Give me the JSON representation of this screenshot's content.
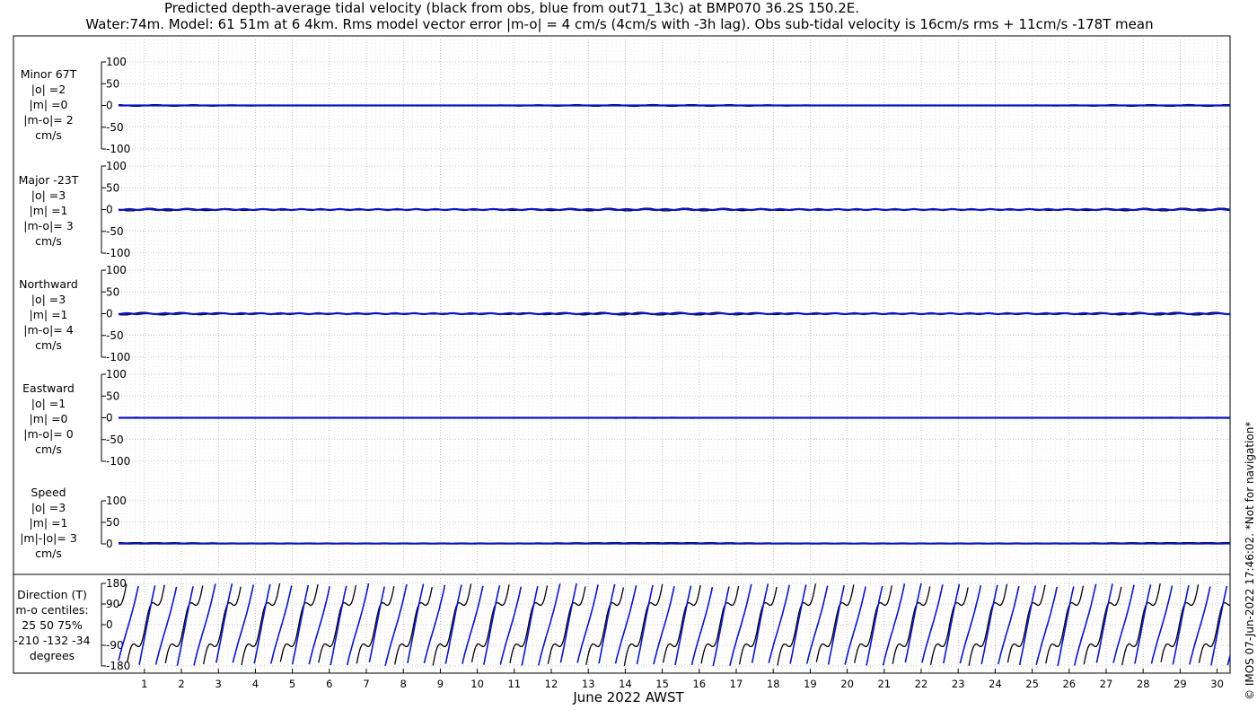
{
  "title_line1": "Predicted depth-average tidal velocity (black from obs, blue from out71_13c) at BMP070 36.2S 150.2E.",
  "title_line2": "Water:74m. Model: 61 51m at 6 4km. Rms model vector error |m-o| = 4 cm/s (4cm/s with -3h lag). Obs sub-tidal velocity is 16cm/s rms + 11cm/s -178T mean",
  "copyright": "© IMOS 07-Jun-2022 17:46:02. *Not for navigation*",
  "colors": {
    "obs": "#000000",
    "model": "#0a14c8"
  },
  "chart_data": [
    {
      "type": "line",
      "panel": "minor",
      "label_lines": [
        "Minor 67T",
        "|o| =2",
        "|m| =0",
        "|m-o|= 2",
        "cm/s"
      ],
      "ylim": [
        -100,
        100
      ],
      "yticks": [
        100,
        50,
        0,
        -50,
        -100
      ],
      "obs_amplitude": 2,
      "model_amplitude": 0
    },
    {
      "type": "line",
      "panel": "major",
      "label_lines": [
        "Major -23T",
        "|o| =3",
        "|m| =1",
        "|m-o|= 3",
        "cm/s"
      ],
      "ylim": [
        -100,
        100
      ],
      "yticks": [
        100,
        50,
        0,
        -50,
        -100
      ],
      "obs_amplitude": 3,
      "model_amplitude": 1
    },
    {
      "type": "line",
      "panel": "northward",
      "label_lines": [
        "Northward",
        "|o| =3",
        "|m| =1",
        "|m-o|= 4",
        "cm/s"
      ],
      "ylim": [
        -100,
        100
      ],
      "yticks": [
        100,
        50,
        0,
        -50,
        -100
      ],
      "obs_amplitude": 3,
      "model_amplitude": 1
    },
    {
      "type": "line",
      "panel": "eastward",
      "label_lines": [
        "Eastward",
        "|o| =1",
        "|m| =0",
        "|m-o|= 0",
        "cm/s"
      ],
      "ylim": [
        -100,
        100
      ],
      "yticks": [
        100,
        50,
        0,
        -50,
        -100
      ],
      "obs_amplitude": 1,
      "model_amplitude": 0
    },
    {
      "type": "line",
      "panel": "speed",
      "label_lines": [
        "Speed",
        "|o| =3",
        "|m| =1",
        "|m|-|o|= 3",
        "cm/s"
      ],
      "ylim": [
        0,
        100
      ],
      "yticks": [
        100,
        50,
        0
      ],
      "obs_amplitude": 3,
      "model_amplitude": 1
    },
    {
      "type": "line",
      "panel": "direction",
      "label_lines": [
        "Direction (T)",
        "m-o centiles:",
        "25  50  75%",
        "-210 -132  -34",
        "degrees"
      ],
      "ylim": [
        -180,
        180
      ],
      "yticks": [
        180,
        90,
        0,
        -90,
        -180
      ]
    }
  ],
  "x_axis": {
    "label": "June 2022 AWST",
    "xlim": [
      0.3,
      30.35
    ],
    "tick_labels": [
      "1",
      "2",
      "3",
      "4",
      "5",
      "6",
      "7",
      "8",
      "9",
      "10",
      "11",
      "12",
      "13",
      "14",
      "15",
      "16",
      "17",
      "18",
      "19",
      "20",
      "21",
      "22",
      "23",
      "24",
      "25",
      "26",
      "27",
      "28",
      "29",
      "30"
    ],
    "grid": true
  }
}
